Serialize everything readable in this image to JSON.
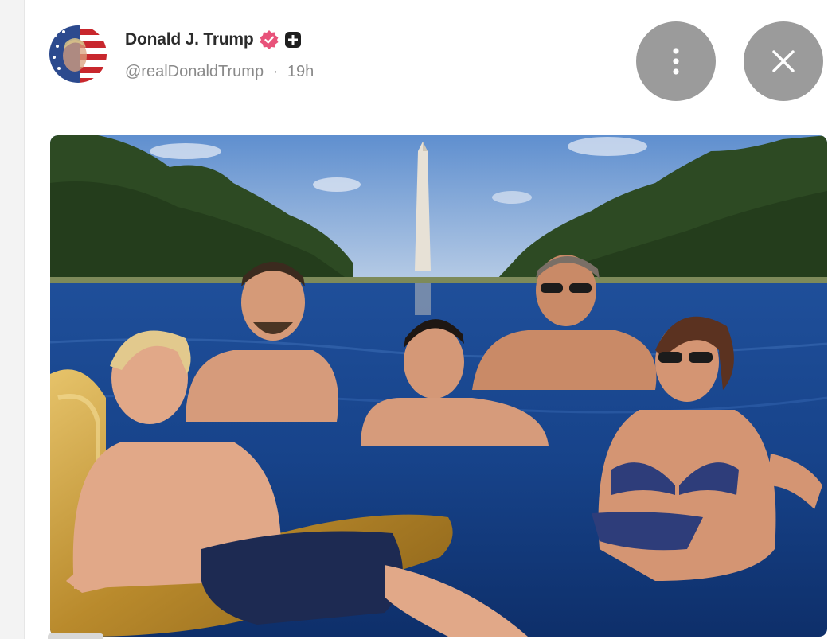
{
  "post": {
    "author_name": "Donald J. Trump",
    "handle": "@realDonaldTrump",
    "separator": "·",
    "timestamp": "19h",
    "avatar_icon": "flag-portrait-avatar",
    "badges": [
      "verified-badge-icon",
      "plus-badge-icon"
    ]
  },
  "actions": {
    "more_icon": "more-vertical-icon",
    "close_icon": "close-icon"
  },
  "media": {
    "type": "photo",
    "subject": "pool-photo"
  },
  "colors": {
    "verified_badge": "#e8527a",
    "button_bg": "#9b9b9b",
    "name_text": "#2b2b2b",
    "meta_text": "#8a8a8a"
  }
}
